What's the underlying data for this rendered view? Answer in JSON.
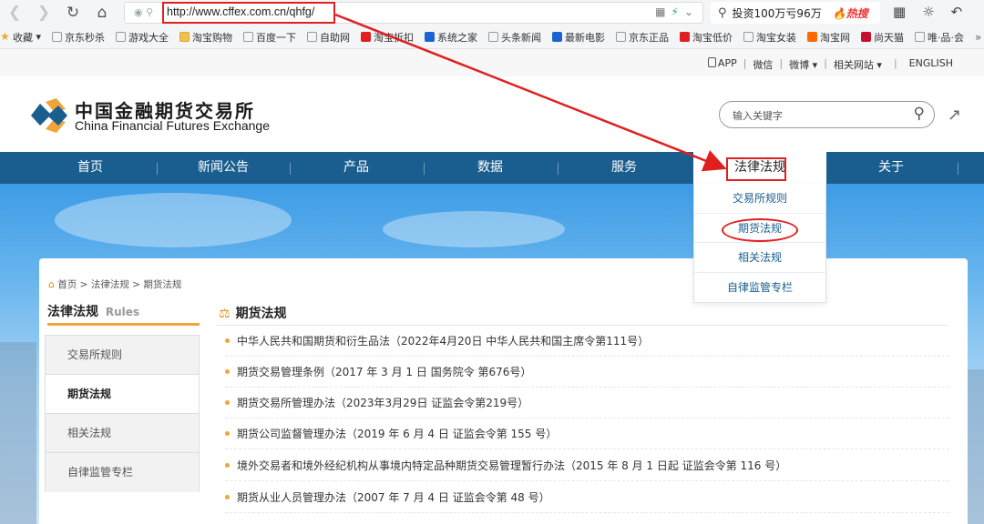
{
  "browser": {
    "url": "http://www.cffex.com.cn/qhfg/",
    "search_query": "投资100万亏96万",
    "search_hot": "热搜",
    "bookmarks": [
      "收藏",
      "京东秒杀",
      "游戏大全",
      "淘宝购物",
      "百度一下",
      "自助网",
      "淘宝折扣",
      "系统之家",
      "头条新闻",
      "最新电影",
      "京东正品",
      "淘宝低价",
      "淘宝女装",
      "淘宝网",
      "尚天猫",
      "唯·品·会"
    ],
    "bookmarks_more": "»"
  },
  "toplinks": {
    "app": "APP",
    "weixin": "微信",
    "weibo": "微博",
    "related": "相关网站",
    "english": "ENGLISH",
    "sep": "|"
  },
  "header": {
    "logo_cn": "中国金融期货交易所",
    "logo_en": "China Financial Futures Exchange",
    "search_placeholder": "输入关键字"
  },
  "nav": {
    "items": [
      "首页",
      "新闻公告",
      "产品",
      "数据",
      "服务",
      "法律法规",
      "关于"
    ],
    "active_index": 5
  },
  "dropdown": {
    "items": [
      "交易所规则",
      "期货法规",
      "相关法规",
      "自律监管专栏"
    ]
  },
  "breadcrumb": {
    "home": "首页",
    "level1": "法律法规",
    "level2": "期货法规",
    "sep": ">"
  },
  "sidebar": {
    "title_cn": "法律法规",
    "title_en": "Rules",
    "items": [
      "交易所规则",
      "期货法规",
      "相关法规",
      "自律监管专栏"
    ],
    "active_index": 1
  },
  "content": {
    "title": "期货法规",
    "items": [
      "中华人民共和国期货和衍生品法（2022年4月20日 中华人民共和国主席令第111号）",
      "期货交易管理条例（2017 年 3 月 1 日 国务院令 第676号）",
      "期货交易所管理办法（2023年3月29日 证监会令第219号）",
      "期货公司监督管理办法（2019 年 6 月 4 日 证监会令第 155 号）",
      "境外交易者和境外经纪机构从事境内特定品种期货交易管理暂行办法（2015 年 8 月 1 日起 证监会令第 116 号）",
      "期货从业人员管理办法（2007 年 7 月 4 日 证监会令第 48 号）"
    ]
  },
  "colors": {
    "nav_bg": "#1a5e8f",
    "accent_orange": "#f0a53a",
    "annotation_red": "#e02020"
  }
}
